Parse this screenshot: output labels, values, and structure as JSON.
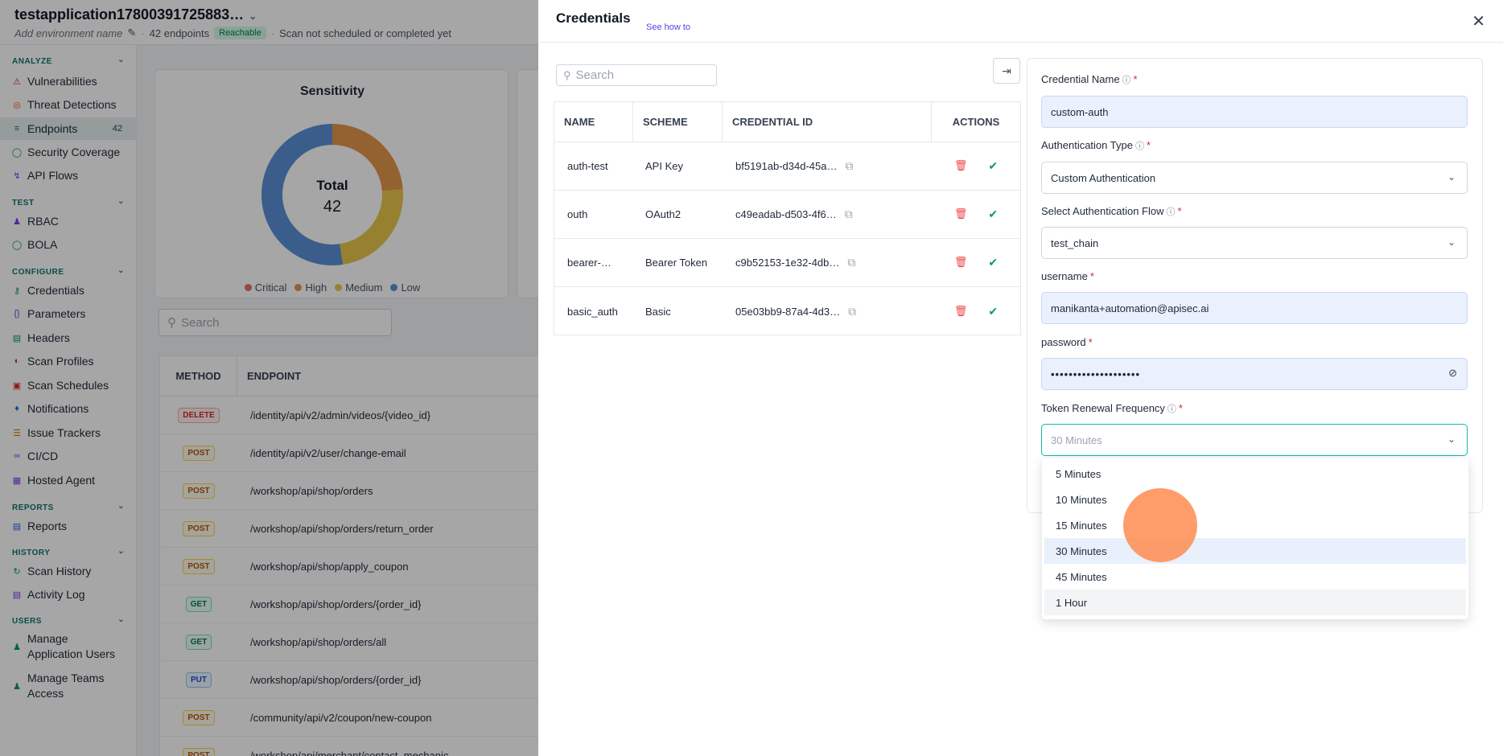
{
  "app": {
    "title": "testapplication17800391725883…",
    "env_name": "Add environment name",
    "endpoints_count": "42 endpoints",
    "reachable": "Reachable",
    "scan_status": "Scan not scheduled or completed yet"
  },
  "sidebar": {
    "sections": {
      "analyze": "ANALYZE",
      "test": "TEST",
      "configure": "CONFIGURE",
      "reports": "REPORTS",
      "history": "HISTORY",
      "users": "USERS"
    },
    "items": {
      "vulnerabilities": "Vulnerabilities",
      "threat_detections": "Threat Detections",
      "endpoints": "Endpoints",
      "endpoints_count": "42",
      "security_coverage": "Security Coverage",
      "api_flows": "API Flows",
      "rbac": "RBAC",
      "bola": "BOLA",
      "credentials": "Credentials",
      "parameters": "Parameters",
      "headers": "Headers",
      "scan_profiles": "Scan Profiles",
      "scan_schedules": "Scan Schedules",
      "notifications": "Notifications",
      "issue_trackers": "Issue Trackers",
      "cicd": "CI/CD",
      "hosted_agent": "Hosted Agent",
      "reports": "Reports",
      "scan_history": "Scan History",
      "activity_log": "Activity Log",
      "manage_app_users": "Manage Application Users",
      "manage_teams": "Manage Teams Access"
    }
  },
  "sensitivity": {
    "title": "Sensitivity",
    "total_label": "Total",
    "total_value": "42",
    "legend": [
      "Critical",
      "High",
      "Medium",
      "Low"
    ],
    "colors": {
      "Critical": "#e76f6f",
      "High": "#e3954b",
      "Medium": "#e8c64b",
      "Low": "#5b8fd6"
    }
  },
  "chart_data": {
    "type": "pie",
    "title": "Sensitivity",
    "categories": [
      "Critical",
      "High",
      "Medium",
      "Low"
    ],
    "values": [
      0,
      10,
      10,
      22
    ]
  },
  "endpoints_table": {
    "search_placeholder": "Search",
    "col_method": "METHOD",
    "col_endpoint": "ENDPOINT",
    "rows": [
      {
        "method": "DELETE",
        "path": "/identity/api/v2/admin/videos/{video_id}"
      },
      {
        "method": "POST",
        "path": "/identity/api/v2/user/change-email"
      },
      {
        "method": "POST",
        "path": "/workshop/api/shop/orders"
      },
      {
        "method": "POST",
        "path": "/workshop/api/shop/orders/return_order"
      },
      {
        "method": "POST",
        "path": "/workshop/api/shop/apply_coupon"
      },
      {
        "method": "GET",
        "path": "/workshop/api/shop/orders/{order_id}"
      },
      {
        "method": "GET",
        "path": "/workshop/api/shop/orders/all"
      },
      {
        "method": "PUT",
        "path": "/workshop/api/shop/orders/{order_id}"
      },
      {
        "method": "POST",
        "path": "/community/api/v2/coupon/new-coupon"
      },
      {
        "method": "POST",
        "path": "/workshop/api/merchant/contact_mechanic"
      }
    ]
  },
  "drawer": {
    "title": "Credentials",
    "see_how": "See how to",
    "search_placeholder": "Search",
    "table": {
      "headers": [
        "NAME",
        "SCHEME",
        "CREDENTIAL ID",
        "ACTIONS"
      ],
      "rows": [
        {
          "name": "auth-test",
          "scheme": "API Key",
          "id": "bf5191ab-d34d-45a…"
        },
        {
          "name": "outh",
          "scheme": "OAuth2",
          "id": "c49eadab-d503-4f6…"
        },
        {
          "name": "bearer-…",
          "scheme": "Bearer Token",
          "id": "c9b52153-1e32-4db…"
        },
        {
          "name": "basic_auth",
          "scheme": "Basic",
          "id": "05e03bb9-87a4-4d3…"
        }
      ]
    },
    "form": {
      "cred_name_label": "Credential Name",
      "cred_name_value": "custom-auth",
      "auth_type_label": "Authentication Type",
      "auth_type_value": "Custom Authentication",
      "auth_flow_label": "Select Authentication Flow",
      "auth_flow_value": "test_chain",
      "username_label": "username",
      "username_value": "manikanta+automation@apisec.ai",
      "password_label": "password",
      "password_value": "••••••••••••••••••••",
      "token_freq_label": "Token Renewal Frequency",
      "token_freq_placeholder": "30 Minutes",
      "token_freq_options": [
        "5 Minutes",
        "10 Minutes",
        "15 Minutes",
        "30 Minutes",
        "45 Minutes",
        "1 Hour"
      ]
    }
  }
}
